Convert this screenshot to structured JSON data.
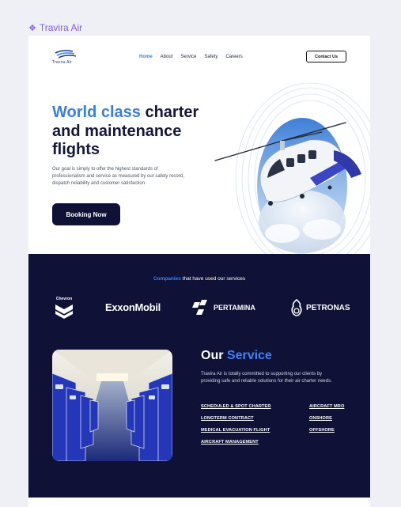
{
  "frame": {
    "name": "Travira Air",
    "icon": "component-icon"
  },
  "nav": {
    "logo_text": "Travira Air",
    "links": [
      {
        "label": "Home",
        "active": true
      },
      {
        "label": "About",
        "active": false
      },
      {
        "label": "Service",
        "active": false
      },
      {
        "label": "Safety",
        "active": false
      },
      {
        "label": "Careers",
        "active": false
      }
    ],
    "contact_label": "Contact Us"
  },
  "hero": {
    "title_accent": "World class",
    "title_rest": " charter and maintenance flights",
    "description": "Our goal is simply to offer the highest standards of professionalism and service as measured by our safety record, dispatch reliability and customer satisfaction",
    "cta_label": "Booking Now",
    "image": "helicopter-over-clouds"
  },
  "partners": {
    "heading_accent": "Companies",
    "heading_rest": " that have used our services",
    "logos": [
      {
        "name": "Chevron"
      },
      {
        "name": "ExxonMobil"
      },
      {
        "name": "PERTAMINA"
      },
      {
        "name": "PETRONAS"
      }
    ]
  },
  "services": {
    "title_plain": "Our ",
    "title_accent": "Service",
    "description": "Travira Air is totally committed to supporting our clients by providing safe and reliable solutions for their air charter needs.",
    "image": "aircraft-cabin-interior",
    "left_links": [
      "SCHEDULED & SPOT CHARTER",
      "LONGTERM CONTRACT",
      "MEDICAL EVACUATION FLIGHT",
      "AIRCRAFT MANAGEMENT"
    ],
    "right_links": [
      "AIRCRAFT MRO",
      "ONSHORE",
      "OFFSHORE"
    ]
  },
  "colors": {
    "accent": "#3b7de0",
    "navy": "#0f1136",
    "frame_label": "#8b5cf6"
  }
}
